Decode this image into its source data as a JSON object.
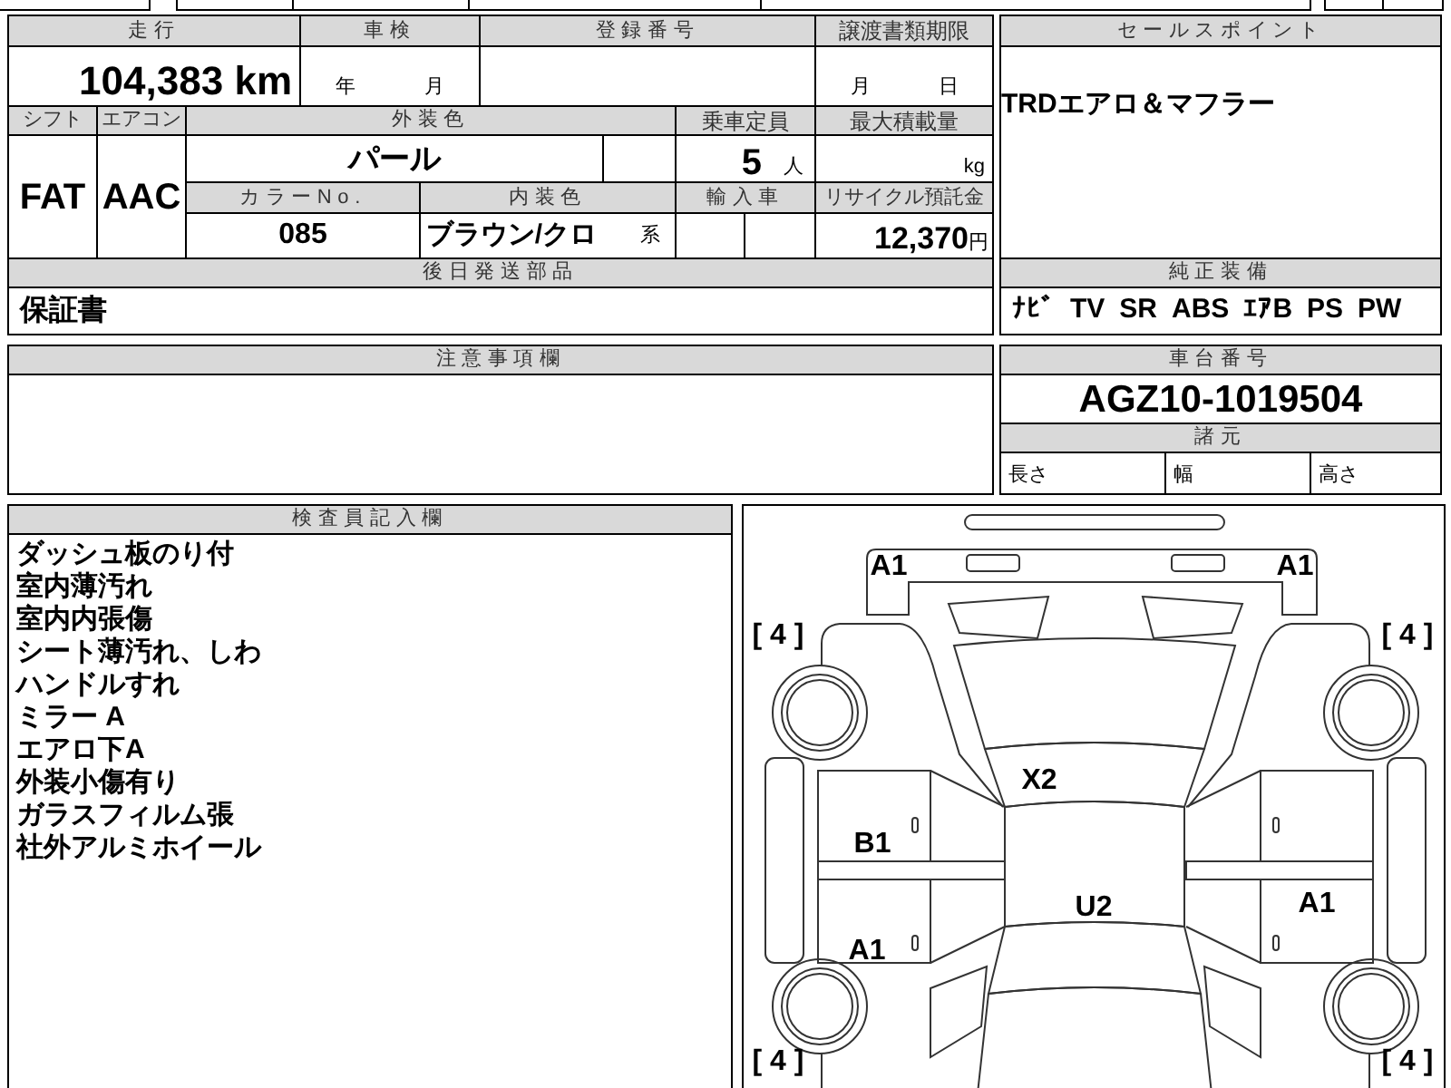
{
  "mileage": {
    "label": "走行",
    "value": "104,383",
    "unit": "km"
  },
  "inspection": {
    "label": "車検",
    "year": "年",
    "month": "月"
  },
  "registration": {
    "label": "登録番号"
  },
  "transfer_deadline": {
    "label": "譲渡書類期限",
    "month": "月",
    "day": "日"
  },
  "shift": {
    "label": "シフト",
    "value": "FAT"
  },
  "aircon": {
    "label": "エアコン",
    "value": "AAC"
  },
  "exterior_color": {
    "label": "外装色",
    "value": "パール"
  },
  "capacity": {
    "label": "乗車定員",
    "value": "5",
    "unit": "人"
  },
  "max_load": {
    "label": "最大積載量",
    "unit": "kg"
  },
  "color_no": {
    "label": "カラーNo.",
    "value": "085"
  },
  "interior_color": {
    "label": "内装色",
    "value": "ブラウン/クロ",
    "suffix": "系"
  },
  "imported": {
    "label": "輸入車"
  },
  "recycle_fee": {
    "label": "リサイクル預託金",
    "value": "12,370",
    "unit": "円"
  },
  "later_parts": {
    "label": "後日発送部品",
    "value": "保証書"
  },
  "sales_point": {
    "label": "セールスポイント",
    "value": "TRDエアロ＆マフラー"
  },
  "equipment": {
    "label": "純正装備",
    "items": [
      "ﾅﾋﾞ",
      "TV",
      "SR",
      "ABS",
      "ｴｱB",
      "PS",
      "PW"
    ]
  },
  "notes": {
    "label": "注意事項欄"
  },
  "chassis_no": {
    "label": "車台番号",
    "value": "AGZ10-1019504"
  },
  "specs": {
    "label": "諸元",
    "fields": [
      "長さ",
      "幅",
      "高さ"
    ]
  },
  "inspector_notes": {
    "label": "検査員記入欄",
    "lines": [
      "ダッシュ板のり付",
      "室内薄汚れ",
      "室内内張傷",
      "シート薄汚れ、しわ",
      "ハンドルすれ",
      "ミラー A",
      "エアロ下A",
      "外装小傷有り",
      "ガラスフィルム張",
      "社外アルミホイール"
    ]
  },
  "diagram": {
    "marks": [
      "A1",
      "A1",
      "[ 4 ]",
      "[ 4 ]",
      "X2",
      "B1",
      "U2",
      "A1",
      "A1",
      "[ 4 ]",
      "[ 4 ]"
    ]
  }
}
